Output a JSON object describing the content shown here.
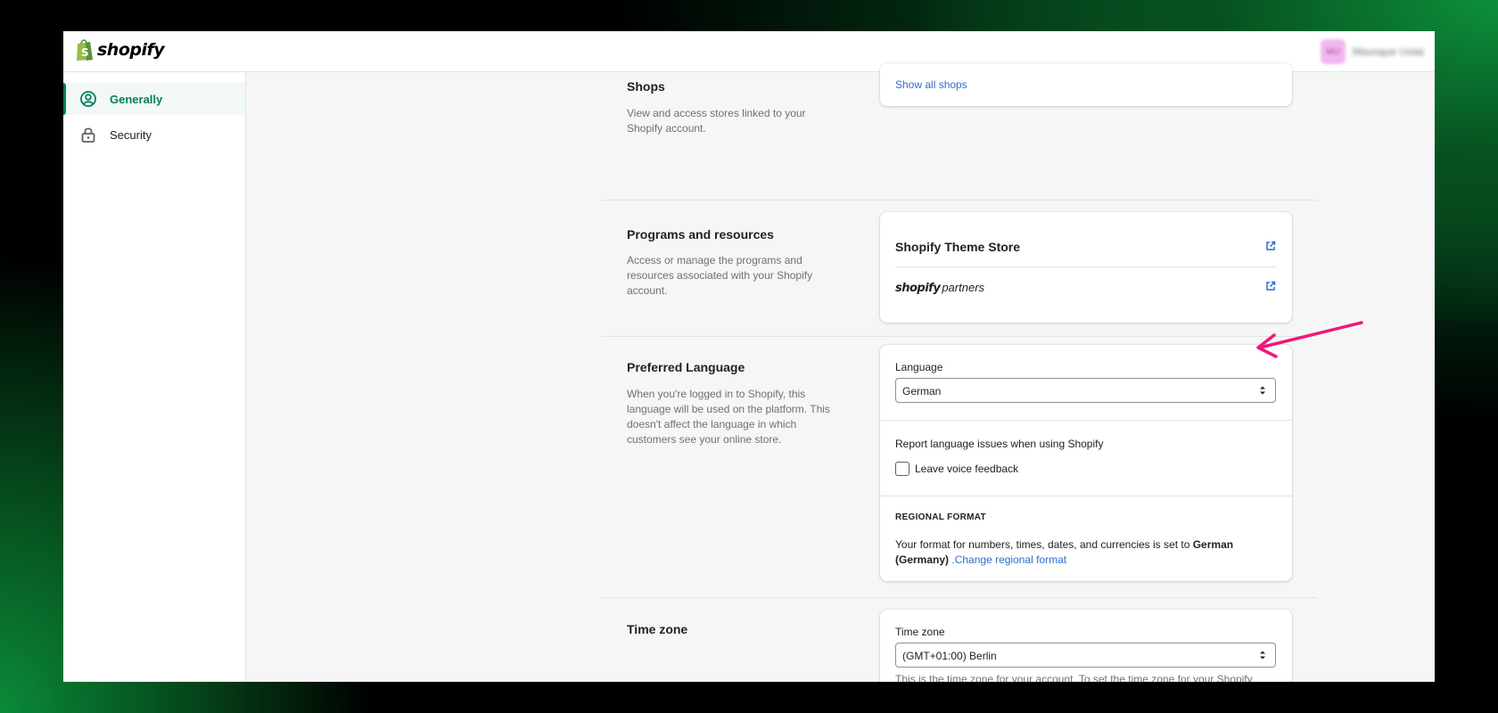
{
  "app": {
    "name": "shopify",
    "user_name": "Mavoque Uolai",
    "avatar_initials": "MU"
  },
  "sidebar": {
    "items": [
      {
        "label": "Generally",
        "icon": "user-circle-icon",
        "active": true
      },
      {
        "label": "Security",
        "icon": "lock-icon",
        "active": false
      }
    ]
  },
  "shops": {
    "title": "Shops",
    "description": "View and access stores linked to your Shopify account.",
    "show_all_link": "Show all shops"
  },
  "programs": {
    "title": "Programs and resources",
    "description": "Access or manage the programs and resources associated with your Shopify account.",
    "theme_store": "Shopify Theme Store",
    "partners_brand": "shopify",
    "partners_word": "partners"
  },
  "language": {
    "title": "Preferred Language",
    "description": "When you're logged in to Shopify, this language will be used on the platform. This doesn't affect the language in which customers see your online store.",
    "field_label": "Language",
    "selected": "German",
    "report_text": "Report language issues when using Shopify",
    "feedback_label": "Leave voice feedback",
    "feedback_checked": false,
    "regional_heading": "REGIONAL FORMAT",
    "regional_text_prefix": "Your format for numbers, times, dates, and currencies is set to",
    "regional_value": "German (Germany)",
    "regional_link": ".Change regional format"
  },
  "timezone": {
    "title": "Time zone",
    "field_label": "Time zone",
    "selected": "(GMT+01:00) Berlin",
    "help_text": "This is the time zone for your account. To set the time zone for your Shopify admin, go to the \"General\" section under \"Settings.\""
  },
  "colors": {
    "accent_green": "#008060",
    "link_blue": "#2c6ecb",
    "annotation_pink": "#f0187a"
  }
}
